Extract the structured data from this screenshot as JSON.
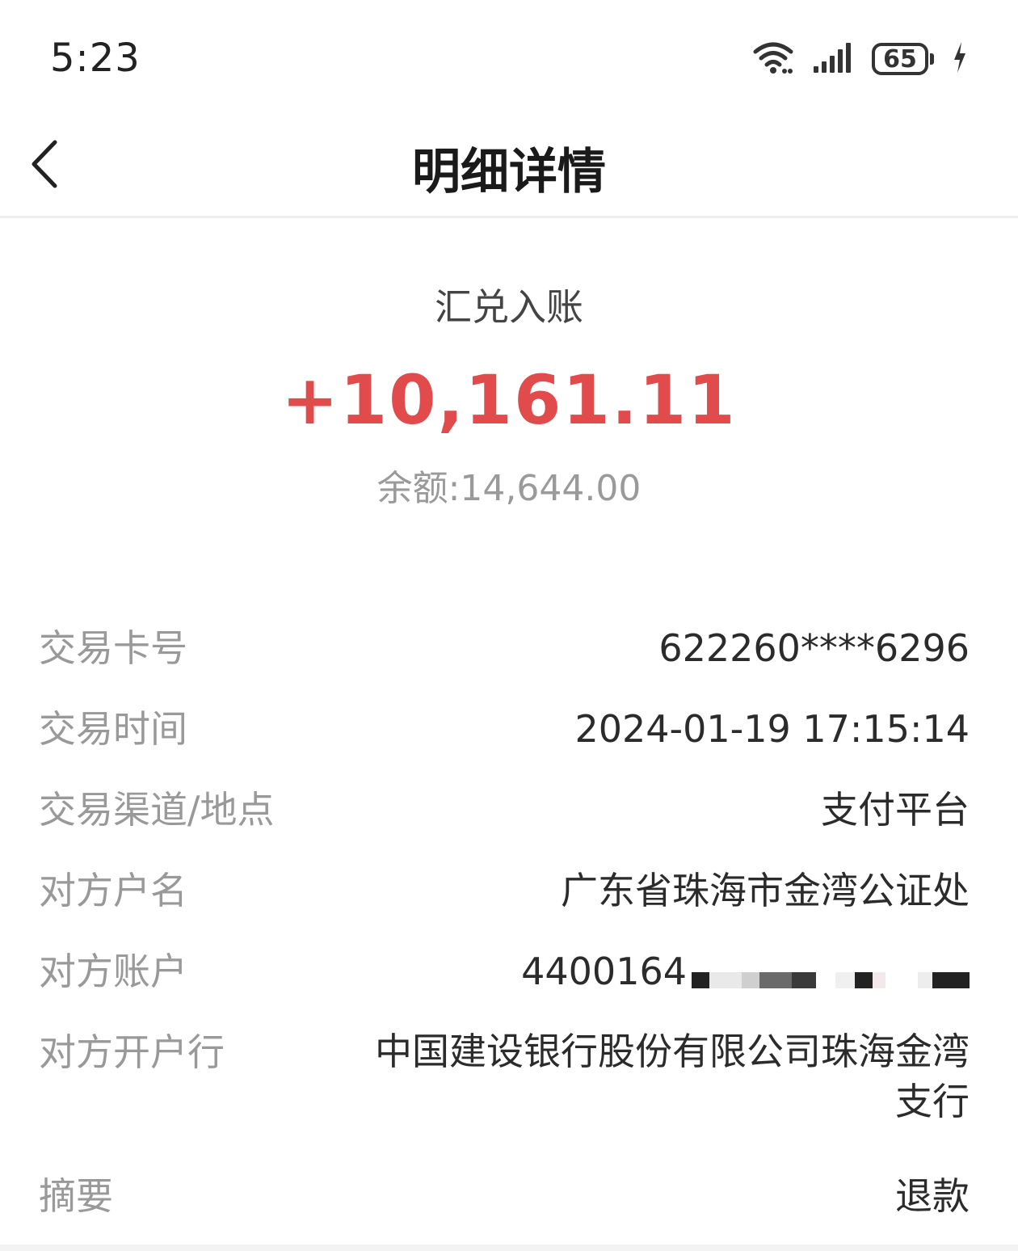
{
  "status_bar": {
    "time": "5:23",
    "battery_level": "65",
    "icons": [
      "wifi-icon",
      "signal-icon",
      "battery-icon",
      "charging-icon"
    ]
  },
  "header": {
    "title": "明细详情",
    "back_icon": "chevron-left-icon"
  },
  "transaction": {
    "type": "汇兑入账",
    "amount": "+10,161.11",
    "balance": "余额:14,644.00",
    "amount_color": "#e24b4b"
  },
  "details": {
    "card_number": {
      "label": "交易卡号",
      "value": "622260****6296"
    },
    "time": {
      "label": "交易时间",
      "value": "2024-01-19 17:15:14"
    },
    "channel": {
      "label": "交易渠道/地点",
      "value": "支付平台"
    },
    "counterparty_name": {
      "label": "对方户名",
      "value": "广东省珠海市金湾公证处"
    },
    "counterparty_account": {
      "label": "对方账户",
      "value": "4400164"
    },
    "counterparty_bank": {
      "label": "对方开户行",
      "value": "中国建设银行股份有限公司珠海金湾支行"
    },
    "memo": {
      "label": "摘要",
      "value": "退款"
    }
  }
}
